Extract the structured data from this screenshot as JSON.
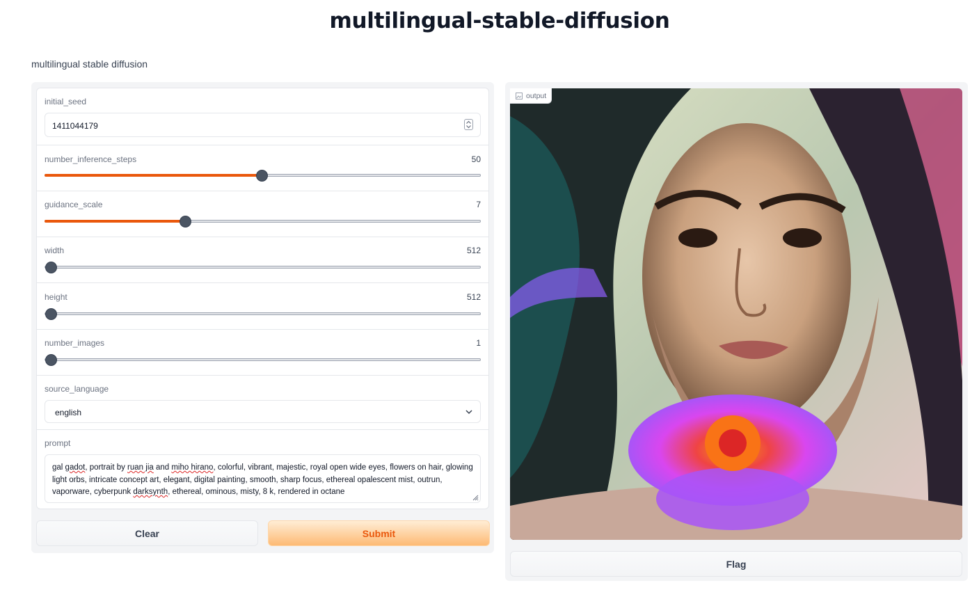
{
  "app": {
    "title": "multilingual-stable-diffusion",
    "description": "multilingual stable diffusion"
  },
  "form": {
    "initial_seed": {
      "label": "initial_seed",
      "value": "1411044179"
    },
    "sliders": [
      {
        "label": "number_inference_steps",
        "value": "50",
        "fraction": 0.496
      },
      {
        "label": "guidance_scale",
        "value": "7",
        "fraction": 0.32
      },
      {
        "label": "width",
        "value": "512",
        "fraction": 0.0
      },
      {
        "label": "height",
        "value": "512",
        "fraction": 0.0
      },
      {
        "label": "number_images",
        "value": "1",
        "fraction": 0.0
      }
    ],
    "source_language": {
      "label": "source_language",
      "selected": "english"
    },
    "prompt": {
      "label": "prompt",
      "value": "gal gadot, portrait by ruan jia and miho hirano, colorful, vibrant, majestic, royal open wide eyes, flowers on hair, glowing light orbs, intricate concept art, elegant, digital painting, smooth, sharp focus, ethereal opalescent mist, outrun, vaporware, cyberpunk darksynth, ethereal, ominous, misty, 8 k, rendered in octane",
      "segments": [
        "gal ",
        "gadot",
        ", portrait by ",
        "ruan jia",
        " and ",
        "miho hirano",
        ", colorful, vibrant, majestic, royal open wide eyes, flowers on hair, glowing light orbs, intricate concept art, elegant, digital painting, smooth, sharp focus, ethereal opalescent mist, outrun, vaporware, cyberpunk ",
        "darksynth",
        ", ethereal, ominous, misty, 8 k, rendered in octane"
      ]
    }
  },
  "buttons": {
    "clear": "Clear",
    "submit": "Submit",
    "flag": "Flag"
  },
  "output": {
    "label": "output",
    "icon": "image-icon"
  },
  "colors": {
    "accent": "#ea580c",
    "submit_text": "#ea580c",
    "submit_bg": "#fdba74"
  }
}
